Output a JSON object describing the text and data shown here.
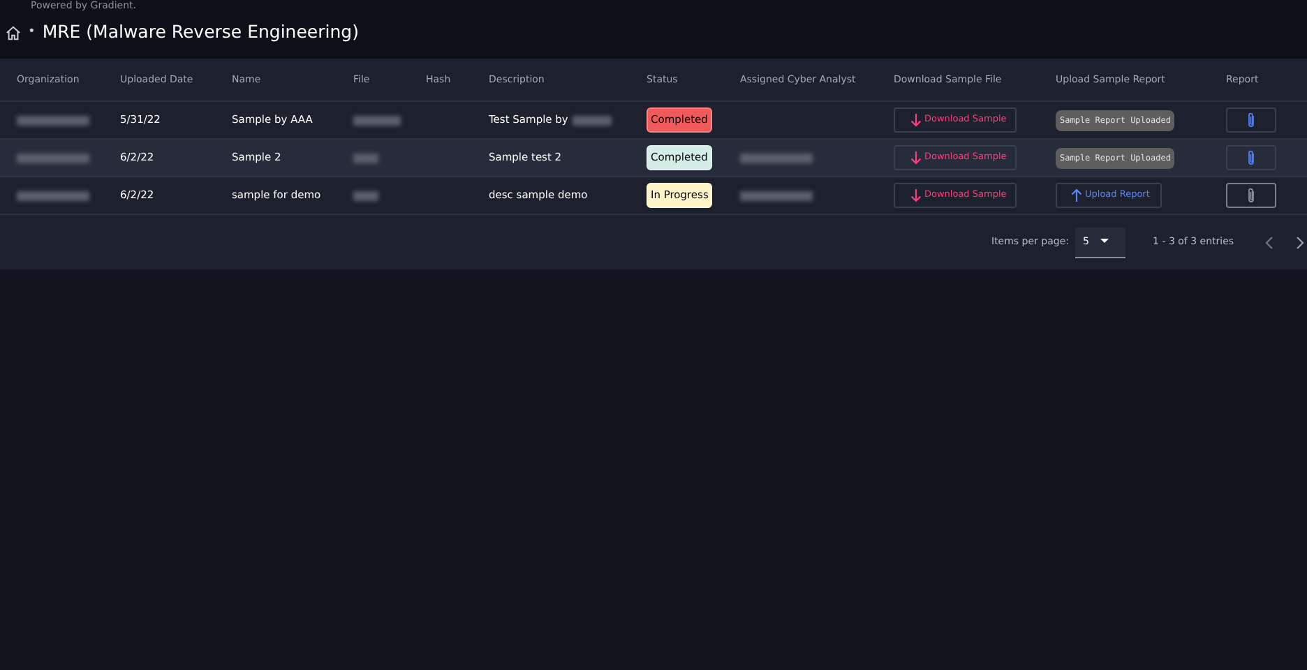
{
  "header": {
    "powered_by": "Powered by Gradient.",
    "breadcrumb_separator": "•",
    "title": "MRE (Malware Reverse Engineering)"
  },
  "table": {
    "columns": [
      "Organization",
      "Uploaded Date",
      "Name",
      "File",
      "Hash",
      "Description",
      "Status",
      "Assigned Cyber Analyst",
      "Download Sample File",
      "Upload Sample Report",
      "Report"
    ],
    "rows": [
      {
        "highlighted": false,
        "uploaded_date": "5/31/22",
        "name": "Sample by AAA",
        "description": "Test Sample by",
        "description_redacted": true,
        "status": {
          "label": "Completed",
          "color": "#f05a5a"
        },
        "analyst_redacted": false,
        "download": "Download Sample",
        "upload": {
          "kind": "uploaded",
          "label": "Sample Report Uploaded"
        },
        "report_attached": true
      },
      {
        "highlighted": true,
        "uploaded_date": "6/2/22",
        "name": "Sample 2",
        "description": "Sample test 2",
        "description_redacted": false,
        "status": {
          "label": "Completed",
          "color": "#d4ede6"
        },
        "analyst_redacted": true,
        "download": "Download Sample",
        "upload": {
          "kind": "uploaded",
          "label": "Sample Report Uploaded"
        },
        "report_attached": true
      },
      {
        "highlighted": false,
        "uploaded_date": "6/2/22",
        "name": "sample for demo",
        "description": "desc sample demo",
        "description_redacted": false,
        "status": {
          "label": "In Progress",
          "color": "#fff4c8"
        },
        "analyst_redacted": true,
        "download": "Download Sample",
        "upload": {
          "kind": "upload",
          "label": "Upload Report"
        },
        "report_attached": false
      }
    ]
  },
  "pagination": {
    "items_per_page_label": "Items per page:",
    "items_per_page": "5",
    "range": "1 - 3 of 3 entries"
  }
}
